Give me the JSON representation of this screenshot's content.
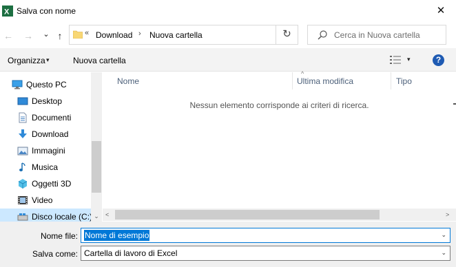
{
  "window": {
    "title": "Salva con nome",
    "close_glyph": "✕",
    "app_icon": "excel-icon"
  },
  "navigation": {
    "back_glyph": "←",
    "forward_glyph": "→",
    "recent_glyph": "⌄",
    "up_glyph": "↑",
    "address": {
      "overflow": "«",
      "crumbs": [
        "Download",
        "Nuova cartella"
      ],
      "separator": "›",
      "dropdown_glyph": "⌄"
    },
    "refresh_glyph": "↻",
    "search": {
      "placeholder": "Cerca in Nuova cartella"
    }
  },
  "toolbar": {
    "organize_label": "Organizza",
    "organize_caret": "▾",
    "new_folder_label": "Nuova cartella",
    "view_caret": "▾",
    "help_glyph": "?"
  },
  "sidebar": {
    "items": [
      {
        "label": "Questo PC",
        "icon": "computer-icon"
      },
      {
        "label": "Desktop",
        "icon": "desktop-icon"
      },
      {
        "label": "Documenti",
        "icon": "documents-icon"
      },
      {
        "label": "Download",
        "icon": "download-icon"
      },
      {
        "label": "Immagini",
        "icon": "pictures-icon"
      },
      {
        "label": "Musica",
        "icon": "music-icon"
      },
      {
        "label": "Oggetti 3D",
        "icon": "3d-objects-icon"
      },
      {
        "label": "Video",
        "icon": "video-icon"
      },
      {
        "label": "Disco locale (C:)",
        "icon": "drive-icon"
      }
    ],
    "scroll_down_glyph": "⌄"
  },
  "file_list": {
    "columns": [
      "Nome",
      "Ultima modifica",
      "Tipo"
    ],
    "sort_glyph": "^",
    "empty_message": "Nessun elemento corrisponde ai criteri di ricerca.",
    "scroll_left_glyph": "<",
    "scroll_right_glyph": ">"
  },
  "save_form": {
    "filename_label": "Nome file:",
    "filename_value": "Nome di esempio",
    "filetype_label": "Salva come:",
    "filetype_value": "Cartella di lavoro di Excel",
    "dropdown_glyph": "⌄"
  },
  "colors": {
    "accent": "#0078d7",
    "selection": "#cce8ff",
    "help": "#1f5bb3",
    "excel": "#1d6f42",
    "folder": "#f8d775"
  }
}
